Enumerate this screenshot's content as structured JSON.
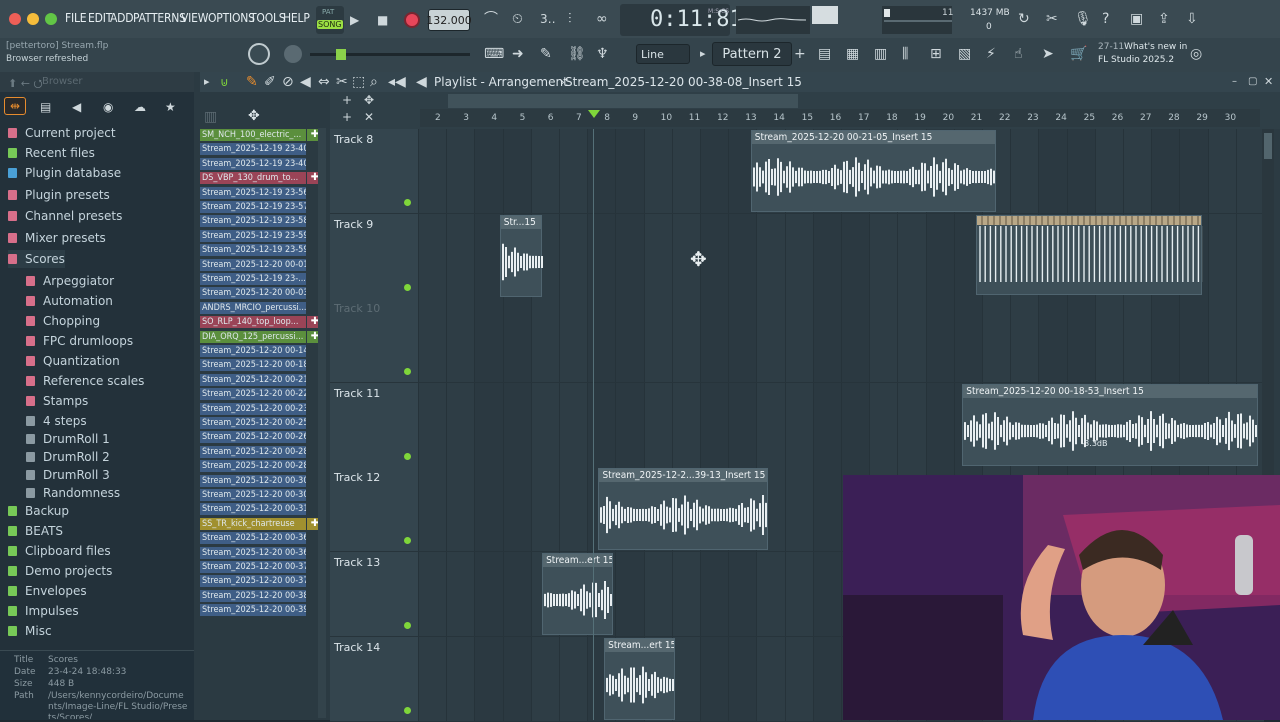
{
  "menu": [
    "FILE",
    "EDIT",
    "ADD",
    "PATTERNS",
    "VIEW",
    "OPTIONS",
    "TOOLS",
    "HELP"
  ],
  "transport": {
    "mode_top": "PAT",
    "mode_bottom": "SONG",
    "tempo": "132.000",
    "time": "0:11:81",
    "time_units": "M:S:CS",
    "cpu": "11",
    "memory": "1437 MB",
    "voices": "0"
  },
  "hint": {
    "line1": "[pettertoro] Stream.flp",
    "line2": "Browser refreshed"
  },
  "snap": "Line",
  "pattern": "Pattern 2",
  "news": {
    "date": "27-11",
    "title": "What's new in",
    "subtitle": "FL Studio 2025.2"
  },
  "browser": {
    "title": "Browser",
    "items": [
      {
        "label": "Current project",
        "color": "#d76f8a",
        "indent": 0
      },
      {
        "label": "Recent files",
        "color": "#77c957",
        "indent": 0
      },
      {
        "label": "Plugin database",
        "color": "#4aa0d6",
        "indent": 0
      },
      {
        "label": "Plugin presets",
        "color": "#d76f8a",
        "indent": 0
      },
      {
        "label": "Channel presets",
        "color": "#d76f8a",
        "indent": 0
      },
      {
        "label": "Mixer presets",
        "color": "#d76f8a",
        "indent": 0
      },
      {
        "label": "Scores",
        "color": "#d76f8a",
        "indent": 0
      },
      {
        "label": "Arpeggiator",
        "color": "#d76f8a",
        "indent": 1
      },
      {
        "label": "Automation",
        "color": "#d76f8a",
        "indent": 1
      },
      {
        "label": "Chopping",
        "color": "#d76f8a",
        "indent": 1
      },
      {
        "label": "FPC drumloops",
        "color": "#d76f8a",
        "indent": 1
      },
      {
        "label": "Quantization",
        "color": "#d76f8a",
        "indent": 1
      },
      {
        "label": "Reference scales",
        "color": "#d76f8a",
        "indent": 1
      },
      {
        "label": "Stamps",
        "color": "#d76f8a",
        "indent": 1
      },
      {
        "label": "4 steps",
        "color": "#8b9aa2",
        "indent": 1
      },
      {
        "label": "DrumRoll 1",
        "color": "#8b9aa2",
        "indent": 1
      },
      {
        "label": "DrumRoll 2",
        "color": "#8b9aa2",
        "indent": 1
      },
      {
        "label": "DrumRoll 3",
        "color": "#8b9aa2",
        "indent": 1
      },
      {
        "label": "Randomness",
        "color": "#8b9aa2",
        "indent": 1
      },
      {
        "label": "Backup",
        "color": "#77c957",
        "indent": 0
      },
      {
        "label": "BEATS",
        "color": "#77c957",
        "indent": 0
      },
      {
        "label": "Clipboard files",
        "color": "#77c957",
        "indent": 0
      },
      {
        "label": "Demo projects",
        "color": "#77c957",
        "indent": 0
      },
      {
        "label": "Envelopes",
        "color": "#77c957",
        "indent": 0
      },
      {
        "label": "Impulses",
        "color": "#77c957",
        "indent": 0
      },
      {
        "label": "Misc",
        "color": "#77c957",
        "indent": 0
      }
    ],
    "info": {
      "title_label": "Title",
      "title": "Scores",
      "date_label": "Date",
      "date": "23-4-24 18:48:33",
      "size_label": "Size",
      "size": "448 B",
      "path_label": "Path",
      "path": "/Users/kennycordeiro/Documents/Image-Line/FL Studio/Presets/Scores/"
    }
  },
  "channels": [
    {
      "label": "SM_NCH_100_electric_...",
      "type": "green"
    },
    {
      "label": "Stream_2025-12-19 23-40-...",
      "type": "blue"
    },
    {
      "label": "Stream_2025-12-19 23-40-...",
      "type": "blue"
    },
    {
      "label": "DS_VBP_130_drum_to...",
      "type": "red"
    },
    {
      "label": "Stream_2025-12-19 23-56-...",
      "type": "blue"
    },
    {
      "label": "Stream_2025-12-19 23-57-...",
      "type": "blue"
    },
    {
      "label": "Stream_2025-12-19 23-58-...",
      "type": "blue"
    },
    {
      "label": "Stream_2025-12-19 23-59-...",
      "type": "blue"
    },
    {
      "label": "Stream_2025-12-19 23-59-...",
      "type": "blue"
    },
    {
      "label": "Stream_2025-12-20 00-01-...",
      "type": "blue"
    },
    {
      "label": "Stream_2025-12-19 23-...",
      "type": "blue"
    },
    {
      "label": "Stream_2025-12-20 00-03-...",
      "type": "blue"
    },
    {
      "label": "ANDRS_MRCIO_percussi...",
      "type": "blue"
    },
    {
      "label": "SO_RLP_140_top_loop...",
      "type": "red"
    },
    {
      "label": "DIA_ORQ_125_percussi...",
      "type": "green"
    },
    {
      "label": "Stream_2025-12-20 00-14-...",
      "type": "blue"
    },
    {
      "label": "Stream_2025-12-20 00-18-...",
      "type": "blue"
    },
    {
      "label": "Stream_2025-12-20 00-21-...",
      "type": "blue"
    },
    {
      "label": "Stream_2025-12-20 00-22-...",
      "type": "blue"
    },
    {
      "label": "Stream_2025-12-20 00-23-...",
      "type": "blue"
    },
    {
      "label": "Stream_2025-12-20 00-25-...",
      "type": "blue"
    },
    {
      "label": "Stream_2025-12-20 00-26-...",
      "type": "blue"
    },
    {
      "label": "Stream_2025-12-20 00-28-...",
      "type": "blue"
    },
    {
      "label": "Stream_2025-12-20 00-28-...",
      "type": "blue"
    },
    {
      "label": "Stream_2025-12-20 00-30-...",
      "type": "blue"
    },
    {
      "label": "Stream_2025-12-20 00-30-...",
      "type": "blue"
    },
    {
      "label": "Stream_2025-12-20 00-31-...",
      "type": "blue"
    },
    {
      "label": "SS_TR_kick_chartreuse",
      "type": "yellow"
    },
    {
      "label": "Stream_2025-12-20 00-36-...",
      "type": "blue"
    },
    {
      "label": "Stream_2025-12-20 00-36-...",
      "type": "blue"
    },
    {
      "label": "Stream_2025-12-20 00-37-...",
      "type": "blue"
    },
    {
      "label": "Stream_2025-12-20 00-37-...",
      "type": "blue"
    },
    {
      "label": "Stream_2025-12-20 00-38-...",
      "type": "blue"
    },
    {
      "label": "Stream_2025-12-20 00-39-...",
      "type": "blue"
    }
  ],
  "playlist": {
    "title": "Playlist - Arrangement",
    "arrangement": "Stream_2025-12-20 00-38-08_Insert 15",
    "bars": [
      "2",
      "3",
      "4",
      "5",
      "6",
      "7",
      "8",
      "9",
      "10",
      "11",
      "12",
      "13",
      "14",
      "15",
      "16",
      "17",
      "18",
      "19",
      "20",
      "21",
      "22",
      "23",
      "24",
      "25",
      "26",
      "27",
      "28",
      "29",
      "30"
    ],
    "tracks": [
      {
        "name": "Track 8",
        "dim": false
      },
      {
        "name": "Track 9",
        "dim": false
      },
      {
        "name": "Track 10",
        "dim": true
      },
      {
        "name": "Track 11",
        "dim": false
      },
      {
        "name": "Track 12",
        "dim": false
      },
      {
        "name": "Track 13",
        "dim": false
      },
      {
        "name": "Track 14",
        "dim": false
      }
    ],
    "clips": [
      {
        "track": 0,
        "label": "Stream_2025-12-20 00-21-05_Insert 15",
        "start": 12.8,
        "length": 8.7
      },
      {
        "track": 1,
        "label": "Str...15",
        "start": 3.9,
        "length": 1.5
      },
      {
        "track": 1,
        "label": "",
        "start": 20.8,
        "length": 8.0,
        "pattern": true
      },
      {
        "track": 3,
        "label": "Stream_2025-12-20 00-18-53_Insert 15",
        "start": 20.3,
        "length": 10.5,
        "gain": "-3.3dB"
      },
      {
        "track": 4,
        "label": "Stream_2025-12-2...39-13_Insert 15",
        "start": 7.4,
        "length": 6.0
      },
      {
        "track": 5,
        "label": "Stream...ert 15",
        "start": 5.4,
        "length": 2.5
      },
      {
        "track": 6,
        "label": "Stream...ert 15",
        "start": 7.6,
        "length": 2.5
      }
    ]
  }
}
